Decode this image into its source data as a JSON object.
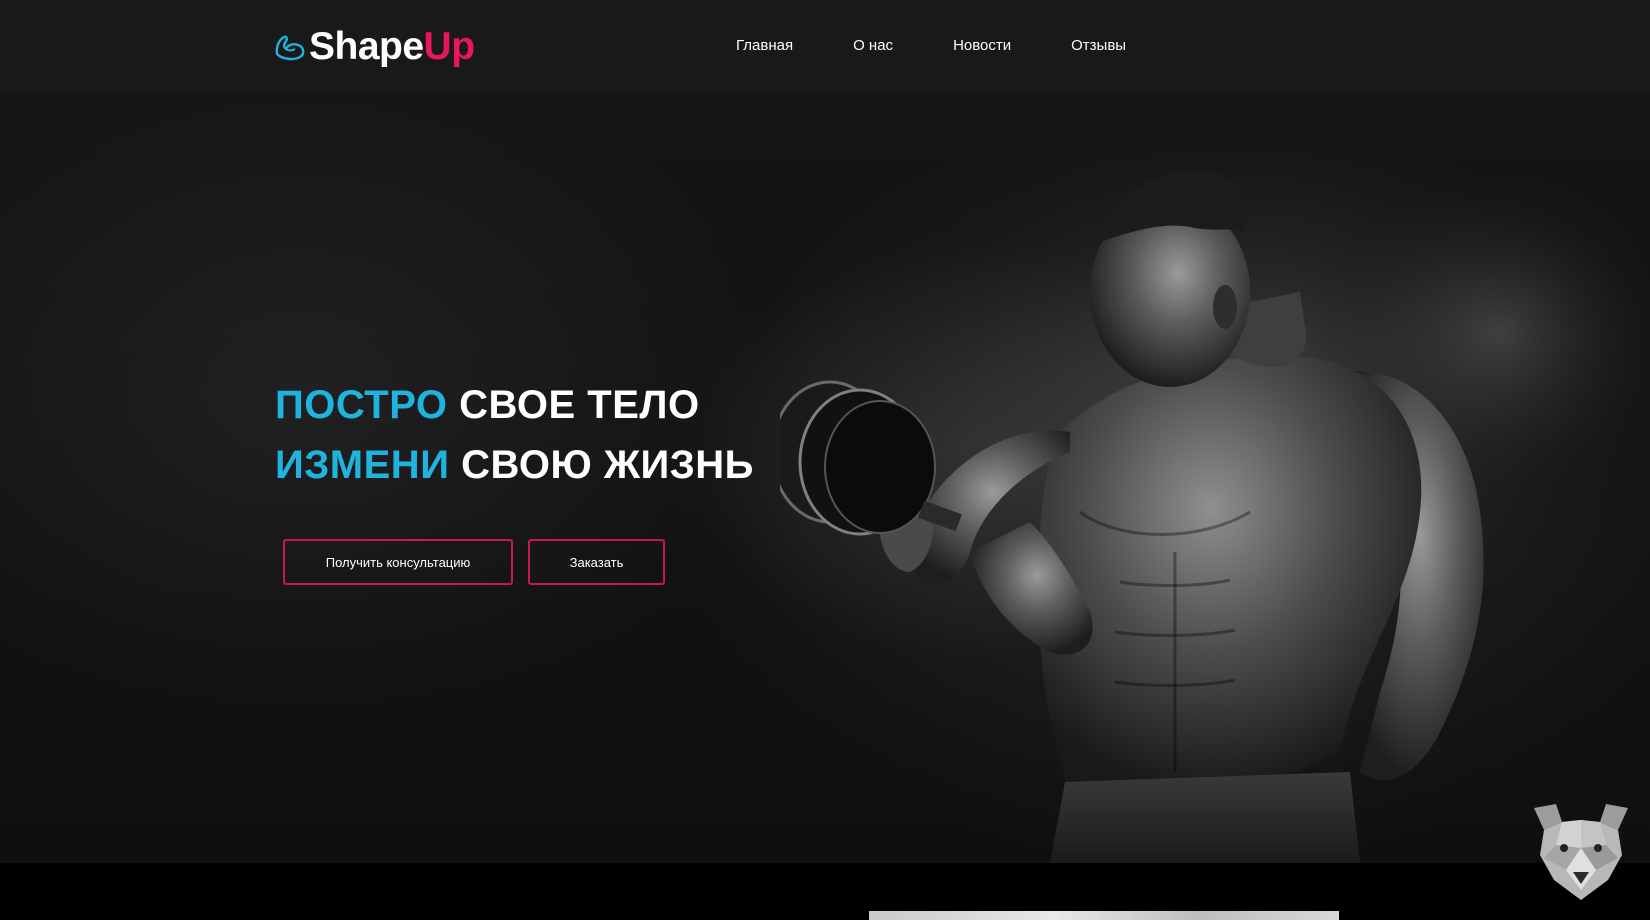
{
  "header": {
    "logo": {
      "part1": "Shape",
      "part2": "Up",
      "icon": "flexed-arm-icon"
    },
    "nav": [
      {
        "label": "Главная"
      },
      {
        "label": "О нас"
      },
      {
        "label": "Новости"
      },
      {
        "label": "Отзывы"
      }
    ]
  },
  "hero": {
    "line1": {
      "accent": "ПОСТРО",
      "rest": "СВОЕ ТЕЛО"
    },
    "line2": {
      "accent": "ИЗМЕНИ",
      "rest": "СВОЮ ЖИЗНЬ"
    },
    "buttons": {
      "consult": "Получить консультацию",
      "order": "Заказать"
    },
    "image": "bodybuilder-with-dumbbell-photo"
  },
  "widgets": {
    "badge_icon": "polygon-bear-icon"
  },
  "colors": {
    "accent_blue": "#1fb3dd",
    "accent_pink": "#e8175d",
    "button_border": "#c61a4d",
    "header_bg": "#19191b"
  }
}
